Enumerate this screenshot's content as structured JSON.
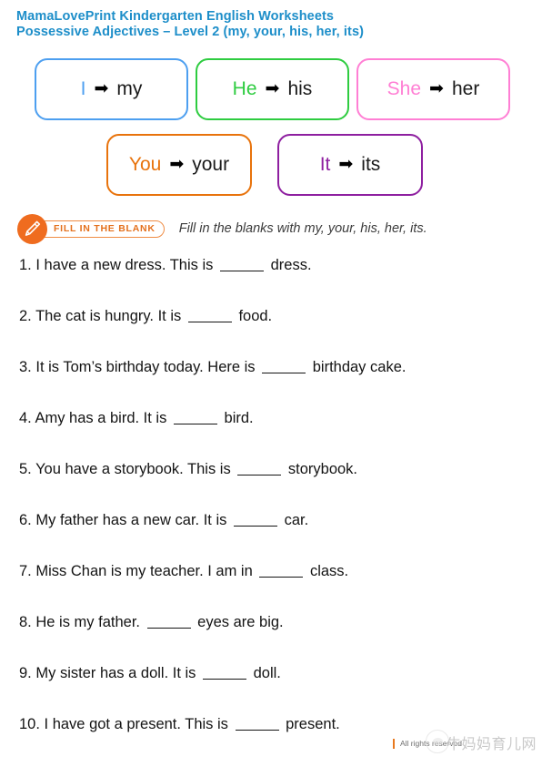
{
  "header": {
    "line1": "MamaLovePrint Kindergarten English Worksheets",
    "line2": "Possessive Adjectives – Level 2 (my, your, his, her, its)",
    "color": "#1d8ec9"
  },
  "pronoun_boxes": {
    "arrow_glyph": "➡",
    "row1": [
      {
        "subject": "I",
        "object": "my",
        "color": "#4d9ff0"
      },
      {
        "subject": "He",
        "object": "his",
        "color": "#2ecc40"
      },
      {
        "subject": "She",
        "object": "her",
        "color": "#ff7fd4"
      }
    ],
    "row2": [
      {
        "subject": "You",
        "object": "your",
        "color": "#e8730c"
      },
      {
        "subject": "It",
        "object": "its",
        "color": "#8e1fa0"
      }
    ]
  },
  "activity": {
    "badge_label": "FILL IN THE BLANK",
    "badge_color": "#e4701c",
    "icon": "pencil-icon",
    "instruction": "Fill in the blanks with my, your, his, her, its."
  },
  "questions": [
    {
      "number": "1.",
      "before": "I have a new dress. This is",
      "after": "dress."
    },
    {
      "number": "2.",
      "before": "The cat is hungry. It is",
      "after": "food."
    },
    {
      "number": "3.",
      "before": "It is Tom’s birthday today. Here is",
      "after": "birthday cake."
    },
    {
      "number": "4.",
      "before": "Amy has a bird. It is",
      "after": "bird."
    },
    {
      "number": "5.",
      "before": "You have a storybook. This is",
      "after": "storybook."
    },
    {
      "number": "6.",
      "before": "My father has a new car. It is",
      "after": "car."
    },
    {
      "number": "7.",
      "before": "Miss Chan is my teacher. I am in",
      "after": "class."
    },
    {
      "number": "8.",
      "before": "He is my father.",
      "after": "eyes are big."
    },
    {
      "number": "9.",
      "before": "My sister has a doll. It is",
      "after": "doll."
    },
    {
      "number": "10.",
      "before": "I have got a present. This is",
      "after": "present."
    }
  ],
  "footer": {
    "rights": "All rights reserved",
    "watermark_text": "牛妈妈育儿网"
  }
}
